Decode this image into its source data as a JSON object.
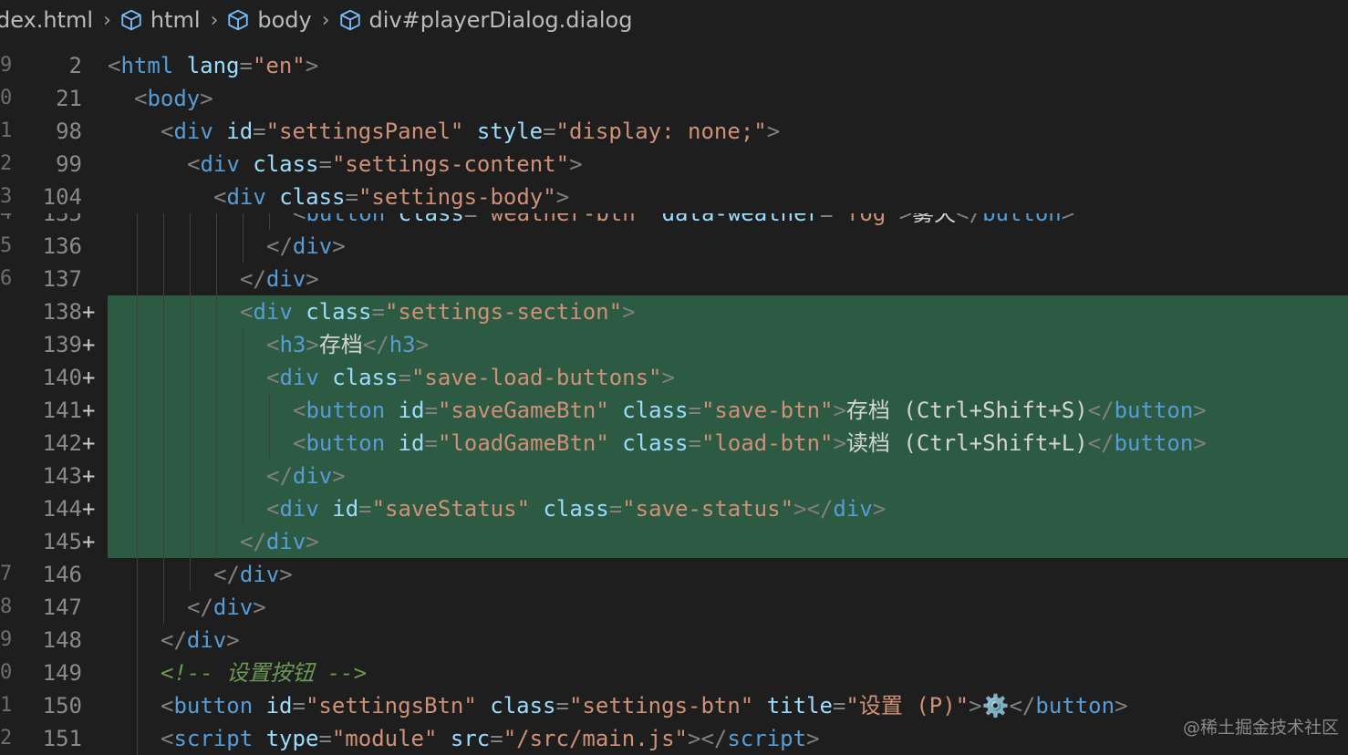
{
  "breadcrumb": {
    "file": "dex.html",
    "items": [
      "html",
      "body",
      "div#playerDialog.dialog"
    ]
  },
  "sticky": [
    {
      "gutter": "9",
      "line": "2",
      "indent": 0,
      "tokens": [
        [
          "p",
          "<"
        ],
        [
          "t",
          "html"
        ],
        [
          "a",
          " lang"
        ],
        [
          "p",
          "="
        ],
        [
          "s",
          "\"en\""
        ],
        [
          "p",
          ">"
        ]
      ]
    },
    {
      "gutter": "0",
      "line": "21",
      "indent": 1,
      "tokens": [
        [
          "p",
          "<"
        ],
        [
          "t",
          "body"
        ],
        [
          "p",
          ">"
        ]
      ]
    },
    {
      "gutter": "1",
      "line": "98",
      "indent": 2,
      "tokens": [
        [
          "p",
          "<"
        ],
        [
          "t",
          "div"
        ],
        [
          "a",
          " id"
        ],
        [
          "p",
          "="
        ],
        [
          "s",
          "\"settingsPanel\""
        ],
        [
          "a",
          " style"
        ],
        [
          "p",
          "="
        ],
        [
          "s",
          "\"display: none;\""
        ],
        [
          "p",
          ">"
        ]
      ]
    },
    {
      "gutter": "2",
      "line": "99",
      "indent": 3,
      "tokens": [
        [
          "p",
          "<"
        ],
        [
          "t",
          "div"
        ],
        [
          "a",
          " class"
        ],
        [
          "p",
          "="
        ],
        [
          "s",
          "\"settings-content\""
        ],
        [
          "p",
          ">"
        ]
      ]
    },
    {
      "gutter": "3",
      "line": "104",
      "indent": 4,
      "tokens": [
        [
          "p",
          "<"
        ],
        [
          "t",
          "div"
        ],
        [
          "a",
          " class"
        ],
        [
          "p",
          "="
        ],
        [
          "s",
          "\"settings-body\""
        ],
        [
          "p",
          ">"
        ]
      ]
    }
  ],
  "cut_line": {
    "gutter": "4",
    "line": "135",
    "indent": 7,
    "tokens": [
      [
        "p",
        "<"
      ],
      [
        "t",
        "button"
      ],
      [
        "a",
        " class"
      ],
      [
        "p",
        "="
      ],
      [
        "s",
        "\"weather-btn\""
      ],
      [
        "a",
        " data-weather"
      ],
      [
        "p",
        "="
      ],
      [
        "s",
        "\"fog\""
      ],
      [
        "p",
        ">"
      ],
      [
        "x",
        "雾天"
      ],
      [
        "p",
        "</"
      ],
      [
        "t",
        "button"
      ],
      [
        "p",
        ">"
      ]
    ]
  },
  "lines": [
    {
      "gutter": "5",
      "line": "136",
      "indent": 6,
      "added": false,
      "tokens": [
        [
          "p",
          "</"
        ],
        [
          "t",
          "div"
        ],
        [
          "p",
          ">"
        ]
      ]
    },
    {
      "gutter": "6",
      "line": "137",
      "indent": 5,
      "added": false,
      "tokens": [
        [
          "p",
          "</"
        ],
        [
          "t",
          "div"
        ],
        [
          "p",
          ">"
        ]
      ]
    },
    {
      "gutter": "",
      "line": "138",
      "indent": 5,
      "added": true,
      "tokens": [
        [
          "p",
          "<"
        ],
        [
          "t",
          "div"
        ],
        [
          "a",
          " class"
        ],
        [
          "p",
          "="
        ],
        [
          "s",
          "\"settings-section\""
        ],
        [
          "p",
          ">"
        ]
      ]
    },
    {
      "gutter": "",
      "line": "139",
      "indent": 6,
      "added": true,
      "tokens": [
        [
          "p",
          "<"
        ],
        [
          "t",
          "h3"
        ],
        [
          "p",
          ">"
        ],
        [
          "x",
          "存档"
        ],
        [
          "p",
          "</"
        ],
        [
          "t",
          "h3"
        ],
        [
          "p",
          ">"
        ]
      ]
    },
    {
      "gutter": "",
      "line": "140",
      "indent": 6,
      "added": true,
      "tokens": [
        [
          "p",
          "<"
        ],
        [
          "t",
          "div"
        ],
        [
          "a",
          " class"
        ],
        [
          "p",
          "="
        ],
        [
          "s",
          "\"save-load-buttons\""
        ],
        [
          "p",
          ">"
        ]
      ]
    },
    {
      "gutter": "",
      "line": "141",
      "indent": 7,
      "added": true,
      "tokens": [
        [
          "p",
          "<"
        ],
        [
          "t",
          "button"
        ],
        [
          "a",
          " id"
        ],
        [
          "p",
          "="
        ],
        [
          "s",
          "\"saveGameBtn\""
        ],
        [
          "a",
          " class"
        ],
        [
          "p",
          "="
        ],
        [
          "s",
          "\"save-btn\""
        ],
        [
          "p",
          ">"
        ],
        [
          "x",
          "存档 (Ctrl+Shift+S)"
        ],
        [
          "p",
          "</"
        ],
        [
          "t",
          "button"
        ],
        [
          "p",
          ">"
        ]
      ]
    },
    {
      "gutter": "",
      "line": "142",
      "indent": 7,
      "added": true,
      "tokens": [
        [
          "p",
          "<"
        ],
        [
          "t",
          "button"
        ],
        [
          "a",
          " id"
        ],
        [
          "p",
          "="
        ],
        [
          "s",
          "\"loadGameBtn\""
        ],
        [
          "a",
          " class"
        ],
        [
          "p",
          "="
        ],
        [
          "s",
          "\"load-btn\""
        ],
        [
          "p",
          ">"
        ],
        [
          "x",
          "读档 (Ctrl+Shift+L)"
        ],
        [
          "p",
          "</"
        ],
        [
          "t",
          "button"
        ],
        [
          "p",
          ">"
        ]
      ]
    },
    {
      "gutter": "",
      "line": "143",
      "indent": 6,
      "added": true,
      "tokens": [
        [
          "p",
          "</"
        ],
        [
          "t",
          "div"
        ],
        [
          "p",
          ">"
        ]
      ]
    },
    {
      "gutter": "",
      "line": "144",
      "indent": 6,
      "added": true,
      "tokens": [
        [
          "p",
          "<"
        ],
        [
          "t",
          "div"
        ],
        [
          "a",
          " id"
        ],
        [
          "p",
          "="
        ],
        [
          "s",
          "\"saveStatus\""
        ],
        [
          "a",
          " class"
        ],
        [
          "p",
          "="
        ],
        [
          "s",
          "\"save-status\""
        ],
        [
          "p",
          "></"
        ],
        [
          "t",
          "div"
        ],
        [
          "p",
          ">"
        ]
      ]
    },
    {
      "gutter": "",
      "line": "145",
      "indent": 5,
      "added": true,
      "tokens": [
        [
          "p",
          "</"
        ],
        [
          "t",
          "div"
        ],
        [
          "p",
          ">"
        ]
      ]
    },
    {
      "gutter": "7",
      "line": "146",
      "indent": 4,
      "added": false,
      "tokens": [
        [
          "p",
          "</"
        ],
        [
          "t",
          "div"
        ],
        [
          "p",
          ">"
        ]
      ]
    },
    {
      "gutter": "8",
      "line": "147",
      "indent": 3,
      "added": false,
      "tokens": [
        [
          "p",
          "</"
        ],
        [
          "t",
          "div"
        ],
        [
          "p",
          ">"
        ]
      ]
    },
    {
      "gutter": "9",
      "line": "148",
      "indent": 2,
      "added": false,
      "tokens": [
        [
          "p",
          "</"
        ],
        [
          "t",
          "div"
        ],
        [
          "p",
          ">"
        ]
      ]
    },
    {
      "gutter": "0",
      "line": "149",
      "indent": 2,
      "added": false,
      "tokens": [
        [
          "c",
          "<!-- 设置按钮 -->"
        ]
      ]
    },
    {
      "gutter": "1",
      "line": "150",
      "indent": 2,
      "added": false,
      "tokens": [
        [
          "p",
          "<"
        ],
        [
          "t",
          "button"
        ],
        [
          "a",
          " id"
        ],
        [
          "p",
          "="
        ],
        [
          "s",
          "\"settingsBtn\""
        ],
        [
          "a",
          " class"
        ],
        [
          "p",
          "="
        ],
        [
          "s",
          "\"settings-btn\""
        ],
        [
          "a",
          " title"
        ],
        [
          "p",
          "="
        ],
        [
          "s",
          "\"设置 (P)\""
        ],
        [
          "p",
          ">"
        ],
        [
          "x",
          "⚙️"
        ],
        [
          "p",
          "</"
        ],
        [
          "t",
          "button"
        ],
        [
          "p",
          ">"
        ]
      ]
    },
    {
      "gutter": "2",
      "line": "151",
      "indent": 2,
      "added": false,
      "tokens": [
        [
          "p",
          "<"
        ],
        [
          "t",
          "script"
        ],
        [
          "a",
          " type"
        ],
        [
          "p",
          "="
        ],
        [
          "s",
          "\"module\""
        ],
        [
          "a",
          " src"
        ],
        [
          "p",
          "="
        ],
        [
          "s",
          "\"/src/main.js\""
        ],
        [
          "p",
          "></"
        ],
        [
          "t",
          "script"
        ],
        [
          "p",
          ">"
        ]
      ]
    }
  ],
  "added_marker": "+",
  "watermark": "@稀土掘金技术社区",
  "colors": {
    "background": "#1e1e1e",
    "added_line": "#2d5a42",
    "tag": "#569cd6",
    "attribute": "#9cdcfe",
    "string": "#ce9178",
    "comment": "#6a9955",
    "icon": "#75beff"
  }
}
